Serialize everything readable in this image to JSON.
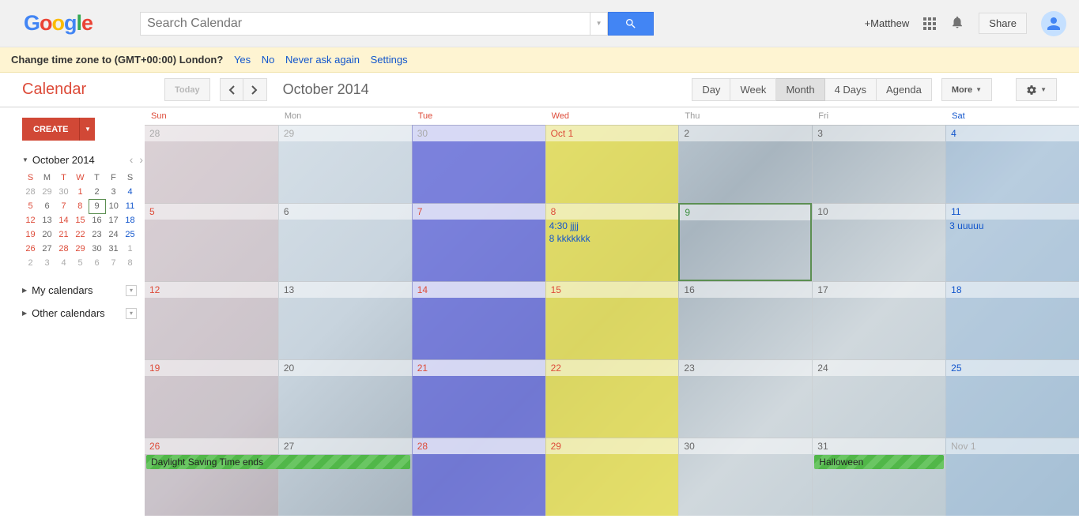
{
  "topbar": {
    "search_placeholder": "Search Calendar",
    "plus_user": "+Matthew",
    "share_label": "Share"
  },
  "notif": {
    "text": "Change time zone to (GMT+00:00) London?",
    "yes": "Yes",
    "no": "No",
    "never": "Never ask again",
    "settings": "Settings"
  },
  "toolbar": {
    "title": "Calendar",
    "today": "Today",
    "period": "October 2014",
    "views": {
      "day": "Day",
      "week": "Week",
      "month": "Month",
      "four": "4 Days",
      "agenda": "Agenda"
    },
    "more": "More"
  },
  "sidebar": {
    "create": "CREATE",
    "mini_month": "October 2014",
    "mini_dow": [
      "S",
      "M",
      "T",
      "W",
      "T",
      "F",
      "S"
    ],
    "mini_rows": [
      [
        "28",
        "29",
        "30",
        "1",
        "2",
        "3",
        "4"
      ],
      [
        "5",
        "6",
        "7",
        "8",
        "9",
        "10",
        "11"
      ],
      [
        "12",
        "13",
        "14",
        "15",
        "16",
        "17",
        "18"
      ],
      [
        "19",
        "20",
        "21",
        "22",
        "23",
        "24",
        "25"
      ],
      [
        "26",
        "27",
        "28",
        "29",
        "30",
        "31",
        "1"
      ],
      [
        "2",
        "3",
        "4",
        "5",
        "6",
        "7",
        "8"
      ]
    ],
    "my_cals": "My calendars",
    "other_cals": "Other calendars"
  },
  "grid": {
    "dow": [
      "Sun",
      "Mon",
      "Tue",
      "Wed",
      "Thu",
      "Fri",
      "Sat"
    ],
    "weeks": [
      {
        "days": [
          {
            "n": "28",
            "cls": "other"
          },
          {
            "n": "29",
            "cls": "other"
          },
          {
            "n": "30",
            "cls": "other"
          },
          {
            "n": "Oct 1",
            "cls": "red"
          },
          {
            "n": "2",
            "cls": ""
          },
          {
            "n": "3",
            "cls": ""
          },
          {
            "n": "4",
            "cls": "blue"
          }
        ]
      },
      {
        "days": [
          {
            "n": "5",
            "cls": "red"
          },
          {
            "n": "6",
            "cls": ""
          },
          {
            "n": "7",
            "cls": "red"
          },
          {
            "n": "8",
            "cls": "red",
            "ev": [
              {
                "t": "4:30 jjjj"
              },
              {
                "t": "8 kkkkkkk"
              }
            ]
          },
          {
            "n": "9",
            "cls": "green",
            "today": true
          },
          {
            "n": "10",
            "cls": ""
          },
          {
            "n": "11",
            "cls": "blue",
            "ev": [
              {
                "t": "3 uuuuu"
              }
            ]
          }
        ]
      },
      {
        "days": [
          {
            "n": "12",
            "cls": "red"
          },
          {
            "n": "13",
            "cls": ""
          },
          {
            "n": "14",
            "cls": "red"
          },
          {
            "n": "15",
            "cls": "red"
          },
          {
            "n": "16",
            "cls": ""
          },
          {
            "n": "17",
            "cls": ""
          },
          {
            "n": "18",
            "cls": "blue"
          }
        ]
      },
      {
        "days": [
          {
            "n": "19",
            "cls": "red"
          },
          {
            "n": "20",
            "cls": ""
          },
          {
            "n": "21",
            "cls": "red"
          },
          {
            "n": "22",
            "cls": "red"
          },
          {
            "n": "23",
            "cls": ""
          },
          {
            "n": "24",
            "cls": ""
          },
          {
            "n": "25",
            "cls": "blue"
          }
        ]
      },
      {
        "days": [
          {
            "n": "26",
            "cls": "red",
            "bar": {
              "t": "Daylight Saving Time ends",
              "stripe": true,
              "span": 2
            }
          },
          {
            "n": "27",
            "cls": ""
          },
          {
            "n": "28",
            "cls": "red"
          },
          {
            "n": "29",
            "cls": "red"
          },
          {
            "n": "30",
            "cls": ""
          },
          {
            "n": "31",
            "cls": "",
            "bar": {
              "t": "Halloween",
              "stripe": true
            }
          },
          {
            "n": "Nov 1",
            "cls": "other"
          }
        ]
      }
    ]
  }
}
